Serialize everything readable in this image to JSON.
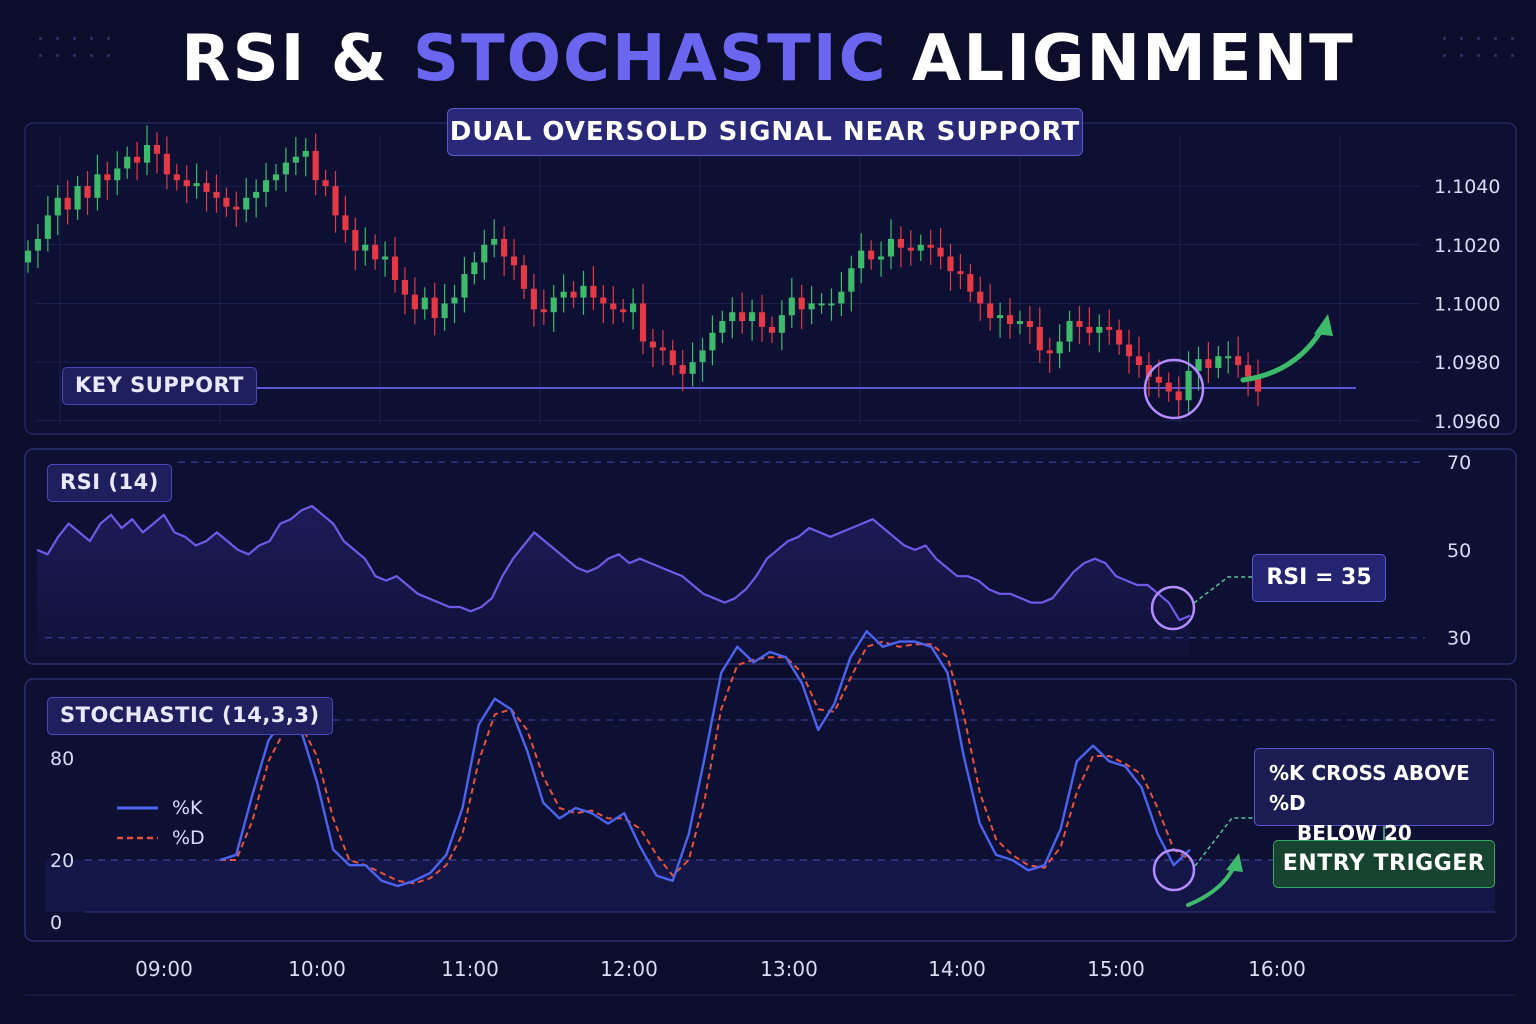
{
  "title": {
    "part1": "RSI & ",
    "accent": "STOCHASTIC",
    "part2": " ALIGNMENT"
  },
  "subtitle": "DUAL OVERSOLD SIGNAL NEAR SUPPORT",
  "colors": {
    "background": "#0b0d2a",
    "accent": "#6b66f0",
    "bullish": "#3dba6a",
    "bearish": "#e53945",
    "rsi_line": "#7059e6",
    "k_line": "#4b63ee",
    "d_line": "#e8523a",
    "highlight": "#b48cff"
  },
  "labels": {
    "support": "KEY SUPPORT",
    "rsi_panel": "RSI (14)",
    "stoch_panel": "STOCHASTIC (14,3,3)",
    "rsi_callout": "RSI = 35",
    "cross_callout_line1": "%K CROSS ABOVE %D",
    "cross_callout_line2": "BELOW 20",
    "entry_callout": "ENTRY TRIGGER"
  },
  "chart_data": [
    {
      "type": "candlestick",
      "time_labels": [
        "09:00",
        "10:00",
        "11:00",
        "12:00",
        "13:00",
        "14:00",
        "15:00",
        "16:00"
      ],
      "y_ticks": [
        1.104,
        1.102,
        1.1,
        1.098,
        1.096
      ],
      "y_tick_labels": [
        "1.1040",
        "1.1020",
        "1.1000",
        "1.0980",
        "1.0960"
      ],
      "ylim": [
        1.09555,
        1.10615
      ],
      "support_level": 1.096,
      "grid": true,
      "close": [
        1.1018,
        1.1022,
        1.103,
        1.1036,
        1.1032,
        1.104,
        1.1036,
        1.1044,
        1.1042,
        1.1046,
        1.105,
        1.1048,
        1.1054,
        1.1051,
        1.1044,
        1.1042,
        1.104,
        1.1041,
        1.1038,
        1.1036,
        1.1033,
        1.1032,
        1.1036,
        1.1038,
        1.1042,
        1.1044,
        1.1048,
        1.105,
        1.1052,
        1.1042,
        1.104,
        1.103,
        1.1025,
        1.1018,
        1.102,
        1.1015,
        1.1016,
        1.1008,
        1.1003,
        1.0998,
        1.1002,
        1.0995,
        1.1,
        1.1002,
        1.101,
        1.1014,
        1.102,
        1.1022,
        1.1016,
        1.1013,
        1.1005,
        1.0998,
        1.0997,
        1.1002,
        1.1004,
        1.1002,
        1.1006,
        1.1002,
        1.1,
        1.0998,
        1.0997,
        1.1,
        1.0987,
        1.0985,
        1.0984,
        1.0979,
        1.0976,
        1.098,
        1.0984,
        1.099,
        1.0994,
        1.0997,
        1.0994,
        1.0997,
        1.0992,
        1.099,
        1.0996,
        1.1002,
        1.0998,
        1.1,
        1.1,
        1.1,
        1.1004,
        1.1012,
        1.1018,
        1.1015,
        1.1016,
        1.1022,
        1.1019,
        1.1018,
        1.102,
        1.1019,
        1.1016,
        1.1011,
        1.101,
        1.1004,
        1.1,
        1.0995,
        1.0996,
        1.0993,
        1.0994,
        1.0992,
        1.0984,
        1.0983,
        1.0987,
        1.0994,
        1.0992,
        1.099,
        1.0992,
        1.0991,
        1.0986,
        1.0982,
        1.0979,
        1.0975,
        1.0973,
        1.097,
        1.0967,
        1.0977,
        1.0981,
        1.0978,
        1.0982,
        1.0982,
        1.0979,
        1.0975,
        1.097
      ]
    },
    {
      "type": "line",
      "name": "RSI (14)",
      "levels": [
        70,
        50,
        30
      ],
      "level_labels": [
        "70",
        "50",
        "30"
      ],
      "ylim": [
        24,
        73
      ],
      "callout_value": 35,
      "values": [
        50,
        49,
        53,
        56,
        54,
        52,
        56,
        58,
        55,
        57,
        54,
        56,
        58,
        54,
        53,
        51,
        52,
        54,
        52,
        50,
        49,
        51,
        52,
        56,
        57,
        59,
        60,
        58,
        56,
        52,
        50,
        48,
        44,
        43,
        44,
        42,
        40,
        39,
        38,
        37,
        37,
        36,
        37,
        39,
        44,
        48,
        51,
        54,
        52,
        50,
        48,
        46,
        45,
        46,
        48,
        49,
        47,
        48,
        47,
        46,
        45,
        44,
        42,
        40,
        39,
        38,
        39,
        41,
        44,
        48,
        50,
        52,
        53,
        55,
        54,
        53,
        54,
        55,
        56,
        57,
        55,
        53,
        51,
        50,
        51,
        48,
        46,
        44,
        44,
        43,
        41,
        40,
        40,
        39,
        38,
        38,
        39,
        42,
        45,
        47,
        48,
        47,
        44,
        43,
        42,
        42,
        40,
        38,
        34,
        35
      ]
    },
    {
      "type": "line",
      "name": "STOCHASTIC (14,3,3)",
      "levels": [
        80,
        20
      ],
      "y_tick_labels": [
        "80",
        "20",
        "0"
      ],
      "ylim": [
        0,
        112
      ],
      "series": [
        {
          "name": "%K",
          "values": [
            20,
            22,
            45,
            66,
            75,
            70,
            50,
            24,
            18,
            18,
            12,
            10,
            12,
            15,
            22,
            40,
            72,
            82,
            78,
            62,
            42,
            36,
            40,
            38,
            34,
            38,
            25,
            14,
            12,
            30,
            60,
            92,
            102,
            96,
            100,
            98,
            88,
            70,
            80,
            98,
            108,
            102,
            104,
            104,
            102,
            92,
            60,
            34,
            22,
            20,
            16,
            18,
            32,
            58,
            64,
            58,
            56,
            48,
            30,
            18,
            24
          ]
        },
        {
          "name": "%D",
          "values": [
            20,
            20,
            35,
            58,
            70,
            72,
            60,
            36,
            20,
            18,
            15,
            12,
            11,
            13,
            18,
            30,
            58,
            76,
            78,
            70,
            52,
            40,
            38,
            39,
            36,
            36,
            32,
            22,
            14,
            20,
            44,
            78,
            95,
            97,
            98,
            98,
            92,
            78,
            77,
            90,
            102,
            104,
            102,
            103,
            103,
            98,
            76,
            46,
            28,
            22,
            18,
            17,
            25,
            46,
            60,
            60,
            57,
            53,
            40,
            24,
            20
          ]
        }
      ]
    }
  ]
}
